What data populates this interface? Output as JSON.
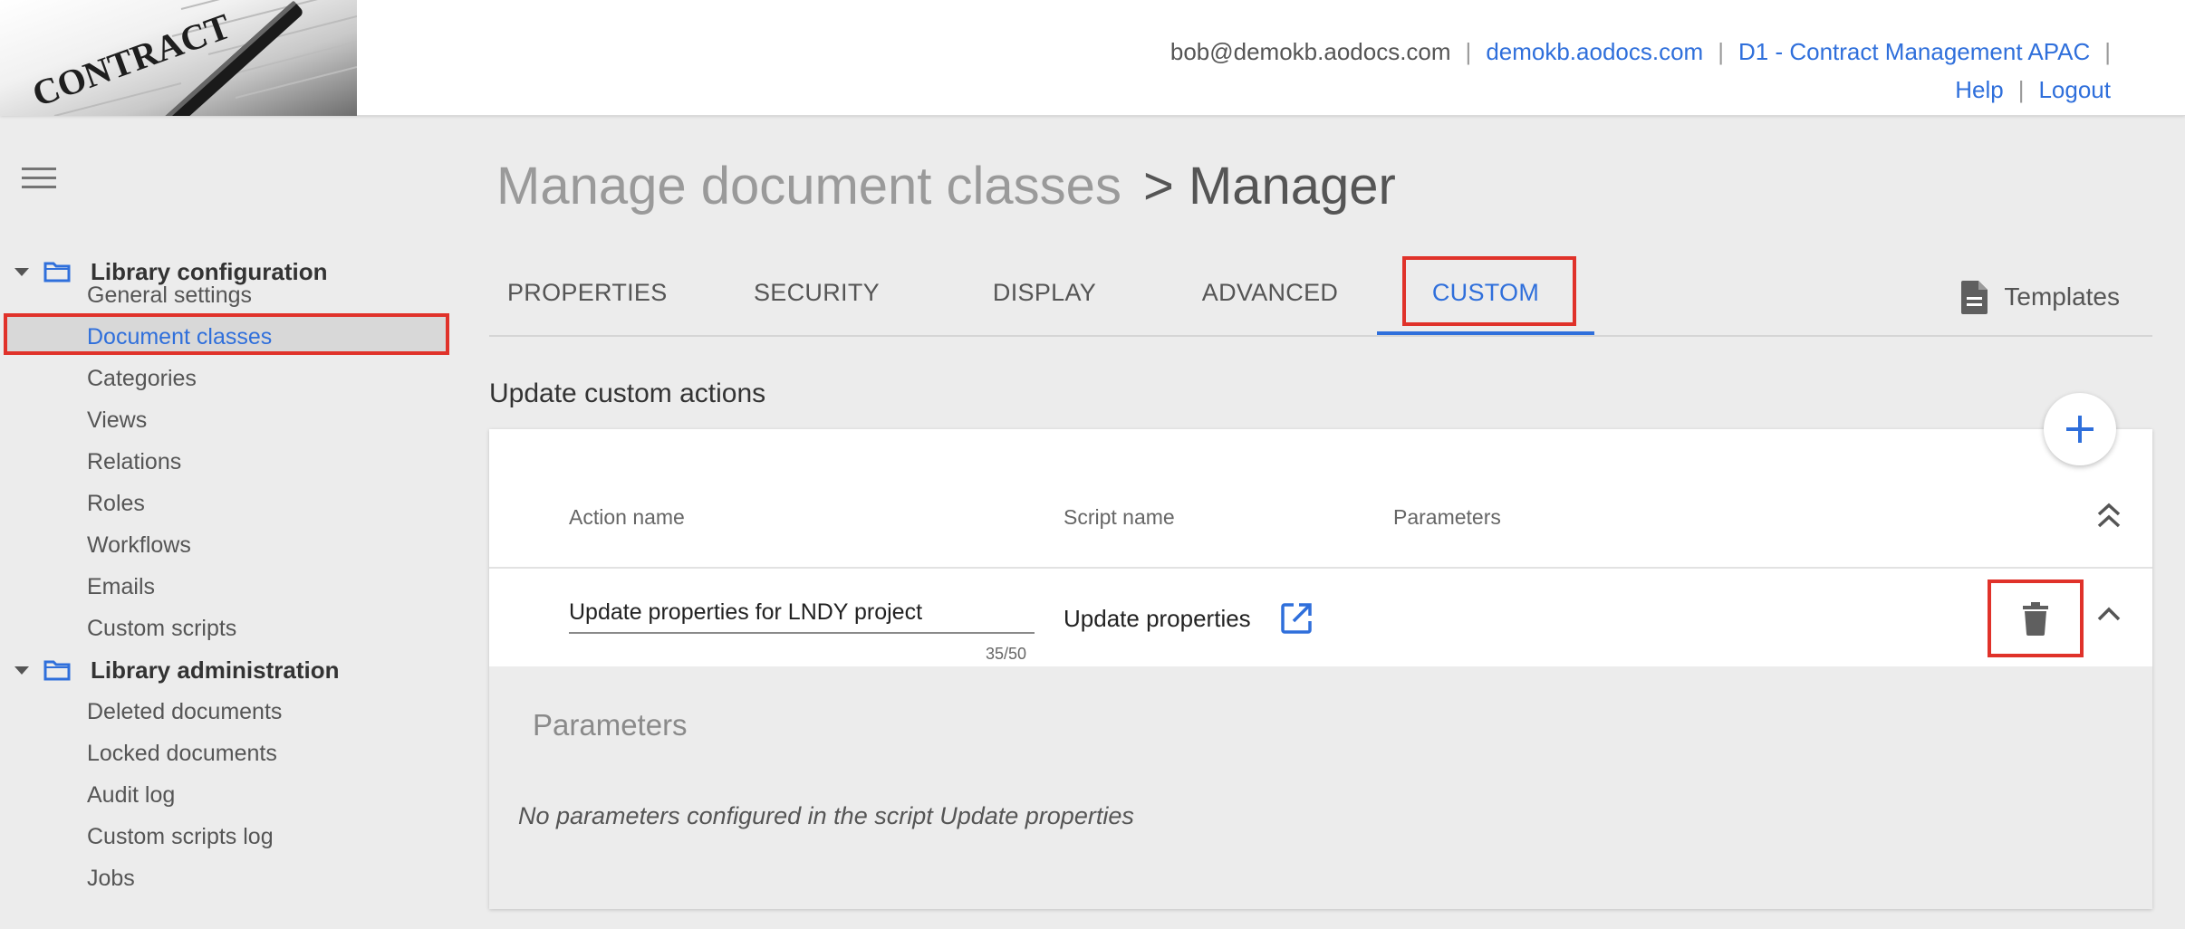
{
  "header": {
    "logo_text": "CONTRACT",
    "user_email": "bob@demokb.aodocs.com",
    "domain_link": "demokb.aodocs.com",
    "library_link": "D1 - Contract Management APAC",
    "help_link": "Help",
    "logout_link": "Logout"
  },
  "sidebar": {
    "sections": [
      {
        "title": "Library configuration",
        "items": [
          "General settings",
          "Document classes",
          "Categories",
          "Views",
          "Relations",
          "Roles",
          "Workflows",
          "Emails",
          "Custom scripts"
        ]
      },
      {
        "title": "Library administration",
        "items": [
          "Deleted documents",
          "Locked documents",
          "Audit log",
          "Custom scripts log",
          "Jobs"
        ]
      }
    ],
    "active_item": "Document classes"
  },
  "page": {
    "title_prefix": "Manage document classes",
    "title_current": "> Manager"
  },
  "tabs": [
    {
      "label": "PROPERTIES"
    },
    {
      "label": "SECURITY"
    },
    {
      "label": "DISPLAY"
    },
    {
      "label": "ADVANCED"
    },
    {
      "label": "CUSTOM"
    }
  ],
  "active_tab": "CUSTOM",
  "templates_label": "Templates",
  "section_title": "Update custom actions",
  "table": {
    "headers": {
      "action_name": "Action name",
      "script_name": "Script name",
      "parameters": "Parameters"
    },
    "row": {
      "action_name": "Update properties for LNDY project",
      "counter": "35/50",
      "script_name": "Update properties"
    }
  },
  "parameters_panel": {
    "title": "Parameters",
    "empty_message": "No parameters configured in the script Update properties"
  },
  "colors": {
    "accent": "#2f6fdb",
    "highlight": "#e0322a",
    "background": "#ececec"
  }
}
